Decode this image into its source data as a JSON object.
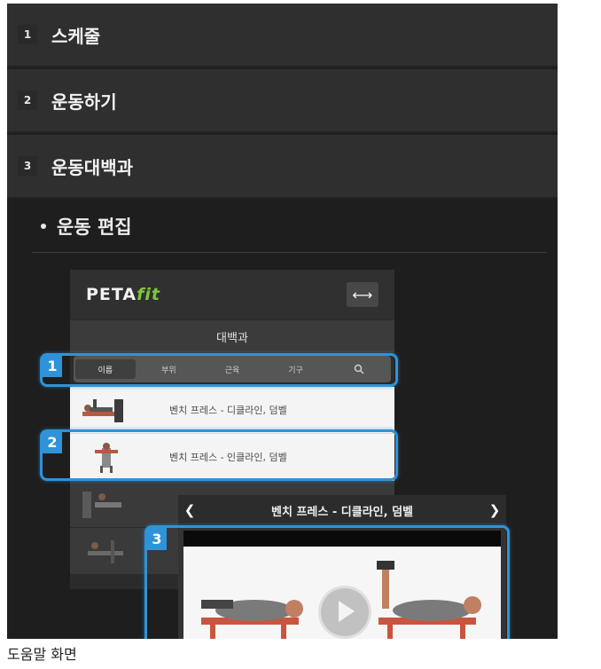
{
  "menu": [
    {
      "num": "1",
      "label": "스케줄"
    },
    {
      "num": "2",
      "label": "운동하기"
    },
    {
      "num": "3",
      "label": "운동대백과"
    }
  ],
  "submenu": {
    "label": "운동 편집"
  },
  "phone": {
    "brand_main": "PETA",
    "brand_accent": "fit",
    "section_title": "대백과",
    "tabs": [
      "이름",
      "부위",
      "근육",
      "기구"
    ],
    "rows": [
      {
        "label": "벤치 프레스 - 디클라인, 덤벨"
      },
      {
        "label": "벤치 프레스 - 인클라인, 덤벨"
      }
    ]
  },
  "callouts": [
    "1",
    "2",
    "3"
  ],
  "player": {
    "title": "벤치 프레스 - 디클라인, 덤벨",
    "prev_icon": "chevron-left-icon",
    "next_icon": "chevron-right-icon"
  },
  "caption": "도움말 화면",
  "colors": {
    "callout": "#2e93d8",
    "panel": "#1e1e1e",
    "menu": "#2f2f2f",
    "brand_accent": "#7ec63a"
  }
}
